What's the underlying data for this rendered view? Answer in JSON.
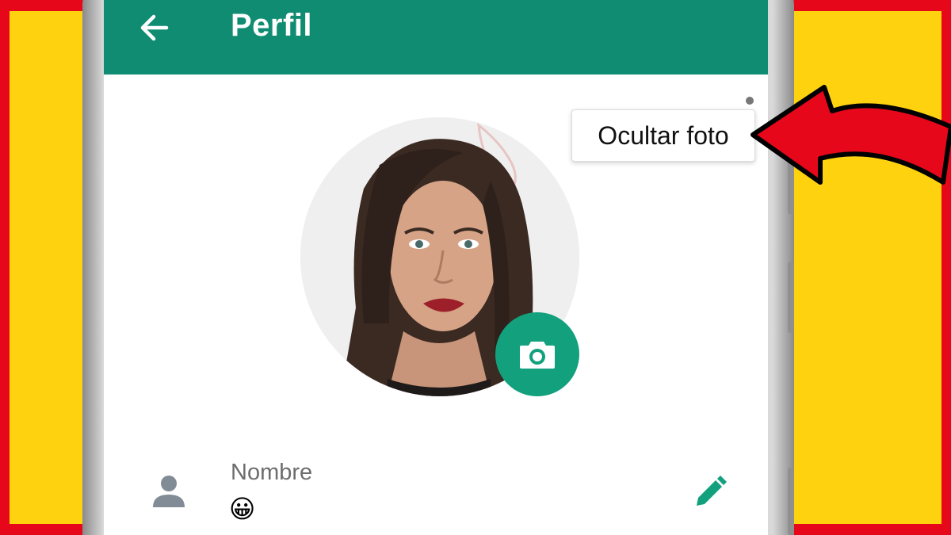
{
  "app_bar": {
    "title": "Perfil",
    "back_icon": "arrow-left-icon",
    "color": "#0f8c72"
  },
  "overflow_menu": {
    "items": [
      {
        "label": "Ocultar foto"
      }
    ]
  },
  "profile_photo": {
    "camera_icon": "camera-icon",
    "camera_button_color": "#12a07d"
  },
  "name_field": {
    "icon": "person-icon",
    "label": "Nombre",
    "value": "😀",
    "edit_icon": "pencil-icon",
    "edit_color": "#12a07d"
  },
  "annotation": {
    "arrow_color": "#e6071a",
    "background_red": "#e6071a",
    "background_yellow": "#ffd20f"
  }
}
